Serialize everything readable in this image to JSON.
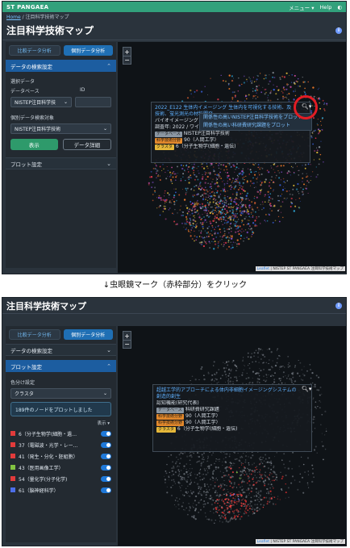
{
  "app": {
    "brand": "ST PANGAEA",
    "menu_label": "メニュー ▾",
    "help_label": "Help",
    "theme_icon": "half-circle-icon",
    "info_icon": "info-icon",
    "page_title": "注目科学技術マップ",
    "breadcrumb_home": "Home",
    "breadcrumb_current": " / 注目科学技術マップ",
    "accent_color": "#32a17c",
    "active_color": "#1c5da0"
  },
  "tabs": {
    "left": "比較データ分析",
    "right": "個別データ分析"
  },
  "shot1": {
    "section_search": "データの検索設定",
    "select_data": "選択データ",
    "database_label": "データベース",
    "id_label": "ID",
    "database_value": "NISTEP注目科学技",
    "individual_label": "個別データ検索対象",
    "individual_value": "NISTEP注目科学技術",
    "show_button": "表示",
    "detail_button": "データ詳細",
    "section_plot": "プロット設定",
    "popup": {
      "title_line1": "2022_E122 生体内イメージング 生体内を可視化する技術、及",
      "title_line2": "技術、蛍光測光の材料開発",
      "line2": "バイオイメージング",
      "line3": "調査年: 2022 / ワイ",
      "tag1": "データベース",
      "tag1_value": "NISTEP注目科学技術",
      "tag2": "科学技術分野",
      "tag2_value": "90（人間工学）",
      "tag3": "クラスタ",
      "tag3_value": "6（分子生物学(細胞・遺伝)"
    },
    "menu": {
      "item1": "関係性の高いNISTEP注目科学技術をプロット",
      "item2": "関係性の高い科研費研究課題をプロット"
    },
    "attribution_leaf": "Leaflet",
    "attribution_text": " | NISTEP ST PANGAEA 注目科学技術マップ"
  },
  "caption": "↓虫眼鏡マーク（赤枠部分）をクリック",
  "shot2": {
    "section_search": "データの検索設定",
    "section_plot": "プロット設定",
    "color_label": "色分け設定",
    "color_value": "クラスタ",
    "plot_note": "189件のノードをプロットしました",
    "hyoji_label": "表示 ▾",
    "legend": [
      {
        "label": "6（分子生物学(細胞・遺…",
        "color": "#e23b3b"
      },
      {
        "label": "37（電磁波・光学・レー…",
        "color": "#e23b3b"
      },
      {
        "label": "41（発生・分化・胚組胞）",
        "color": "#e23b3b"
      },
      {
        "label": "43（医用画像工学）",
        "color": "#82c341"
      },
      {
        "label": "54（量化学(分子化学)",
        "color": "#e23b3b"
      },
      {
        "label": "61（脳神経科学）",
        "color": "#4d6ee8"
      }
    ],
    "popup": {
      "title_line1": "超越工学的アプローチによる体内非細胞イメージングシステムの",
      "title_line2": "創造的創生",
      "line2": "認知機能(研究代表)",
      "tag1": "データベース",
      "tag1_value": "科研費研究課題",
      "tag2": "科学技術分野",
      "tag2_value": "90（人間工学）",
      "tag3": "科学技術分野",
      "tag3_value": "90（人間工学）",
      "tag4": "クラスタ",
      "tag4_value": "6（分子生物学(細胞・遺伝)"
    },
    "attribution_leaf": "Leaflet",
    "attribution_text": " | NISTEP ST PANGAEA 注目科学技術マップ"
  }
}
